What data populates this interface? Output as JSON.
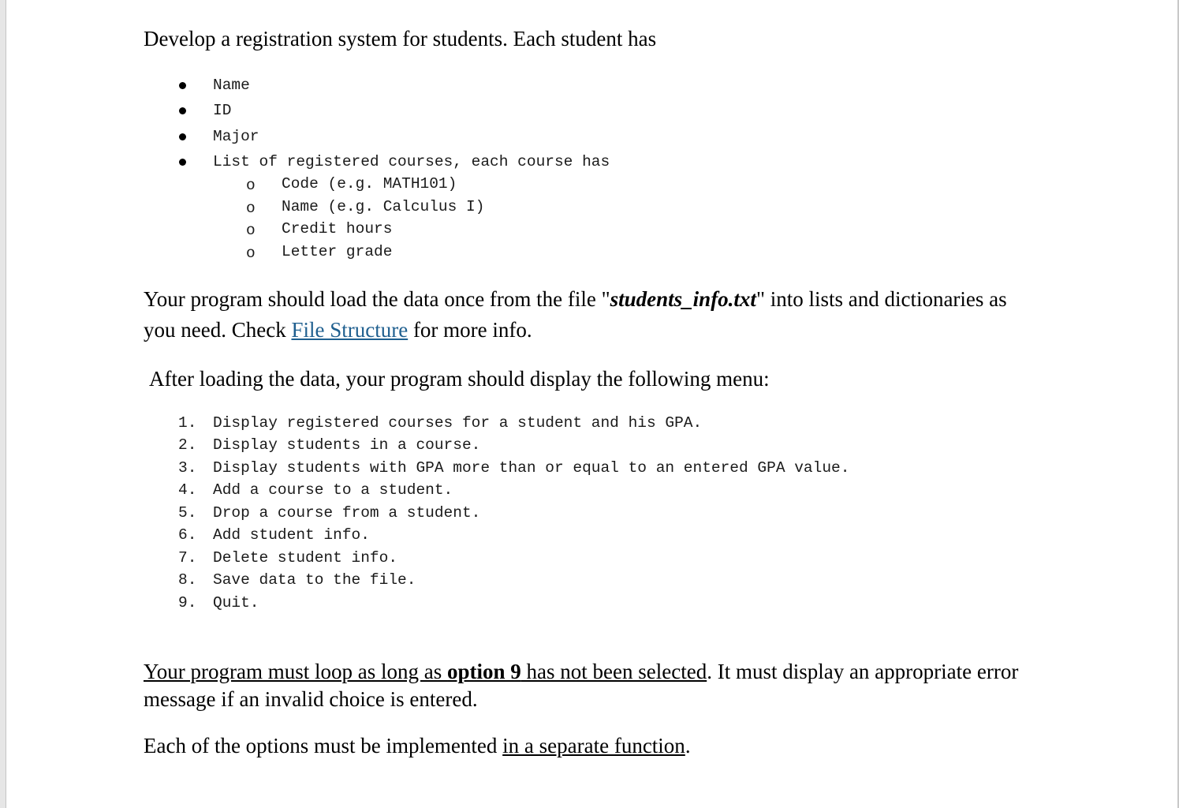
{
  "document": {
    "intro": "Develop a registration system for students. Each student has",
    "student_fields": [
      {
        "label": "Name"
      },
      {
        "label": "ID"
      },
      {
        "label": "Major"
      },
      {
        "label": "List of registered courses, each course has"
      }
    ],
    "course_fields_marker": "o",
    "course_fields": [
      {
        "label": "Code (e.g. MATH101)"
      },
      {
        "label": "Name (e.g. Calculus I)"
      },
      {
        "label": "Credit hours"
      },
      {
        "label": "Letter grade"
      }
    ],
    "load_paragraph": {
      "part1": "Your program should load the data once from the file \"",
      "filename": "students_info.txt",
      "part2": "\" into lists and dictionaries as you need. Check ",
      "link_text": "File Structure",
      "part3": " for more info."
    },
    "menu_intro": "After loading the data, your program should display the following menu:",
    "menu_items": [
      {
        "num": "1.",
        "text": "Display registered courses for a student and his GPA."
      },
      {
        "num": "2.",
        "text": "Display students in a course."
      },
      {
        "num": "3.",
        "text": "Display students with GPA more than or equal to an entered GPA value."
      },
      {
        "num": "4.",
        "text": "Add a course to a student."
      },
      {
        "num": "5.",
        "text": "Drop a course from a student."
      },
      {
        "num": "6.",
        "text": "Add student info."
      },
      {
        "num": "7.",
        "text": "Delete student info."
      },
      {
        "num": "8.",
        "text": "Save data to the file."
      },
      {
        "num": "9.",
        "text": "Quit."
      }
    ],
    "loop_paragraph": {
      "u1": "Your program must loop as long as ",
      "bold": "option 9",
      "u2": " has not been selected",
      "rest": ". It must display an appropriate error message if an invalid choice is entered."
    },
    "function_paragraph": {
      "part1": "Each of the options must be implemented ",
      "underlined": "in a separate function",
      "part2": "."
    },
    "colors": {
      "link": "#1f5f8f"
    }
  }
}
